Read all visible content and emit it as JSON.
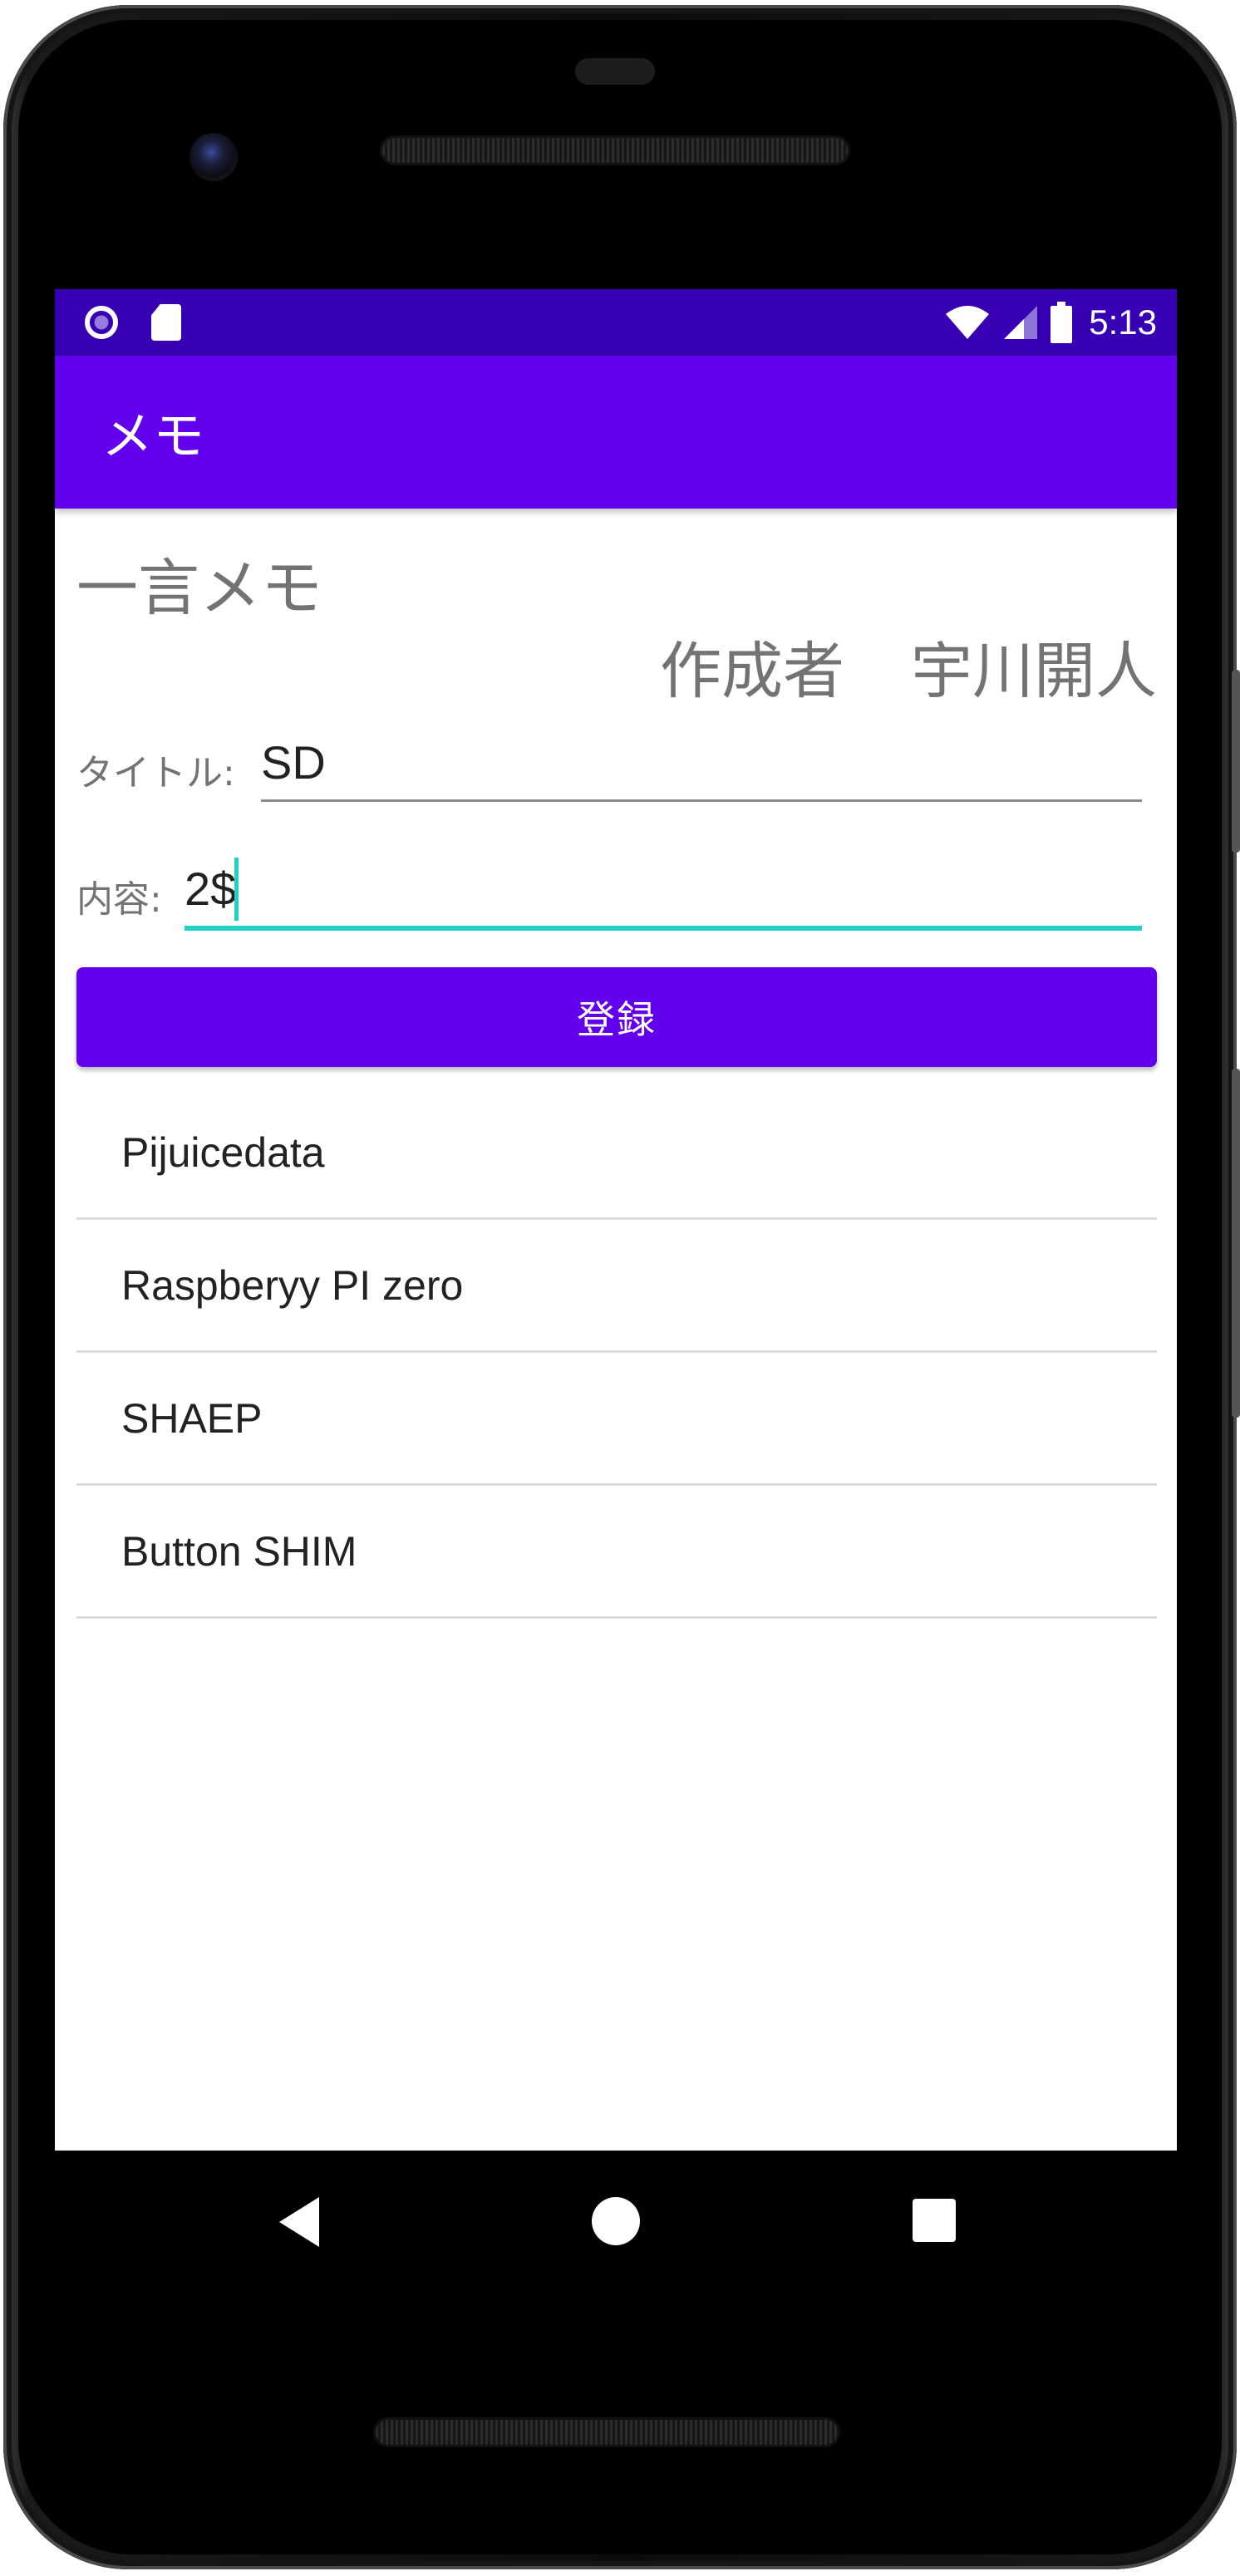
{
  "status_bar": {
    "time": "5:13",
    "left_icons": [
      "notification-circle-icon",
      "sd-card-icon"
    ],
    "right_icons": [
      "wifi-icon",
      "cell-signal-icon",
      "battery-icon"
    ]
  },
  "app_bar": {
    "title": "メモ"
  },
  "main": {
    "heading": "一言メモ",
    "author_label": "作成者",
    "author_name": "宇川開人",
    "title_field": {
      "label": "タイトル:",
      "value": "SD"
    },
    "content_field": {
      "label": "内容:",
      "value": "2$"
    },
    "register_button": "登録",
    "memos": [
      "Pijuicedata",
      "Raspberyy PI zero",
      "SHAEP",
      "Button SHIM"
    ]
  },
  "colors": {
    "status_bar": "#3700b3",
    "primary": "#6200ee",
    "accent": "#21d0c6",
    "label_gray": "#737373"
  },
  "nav_bar": {
    "icons": [
      "back-icon",
      "home-icon",
      "recents-icon"
    ]
  }
}
